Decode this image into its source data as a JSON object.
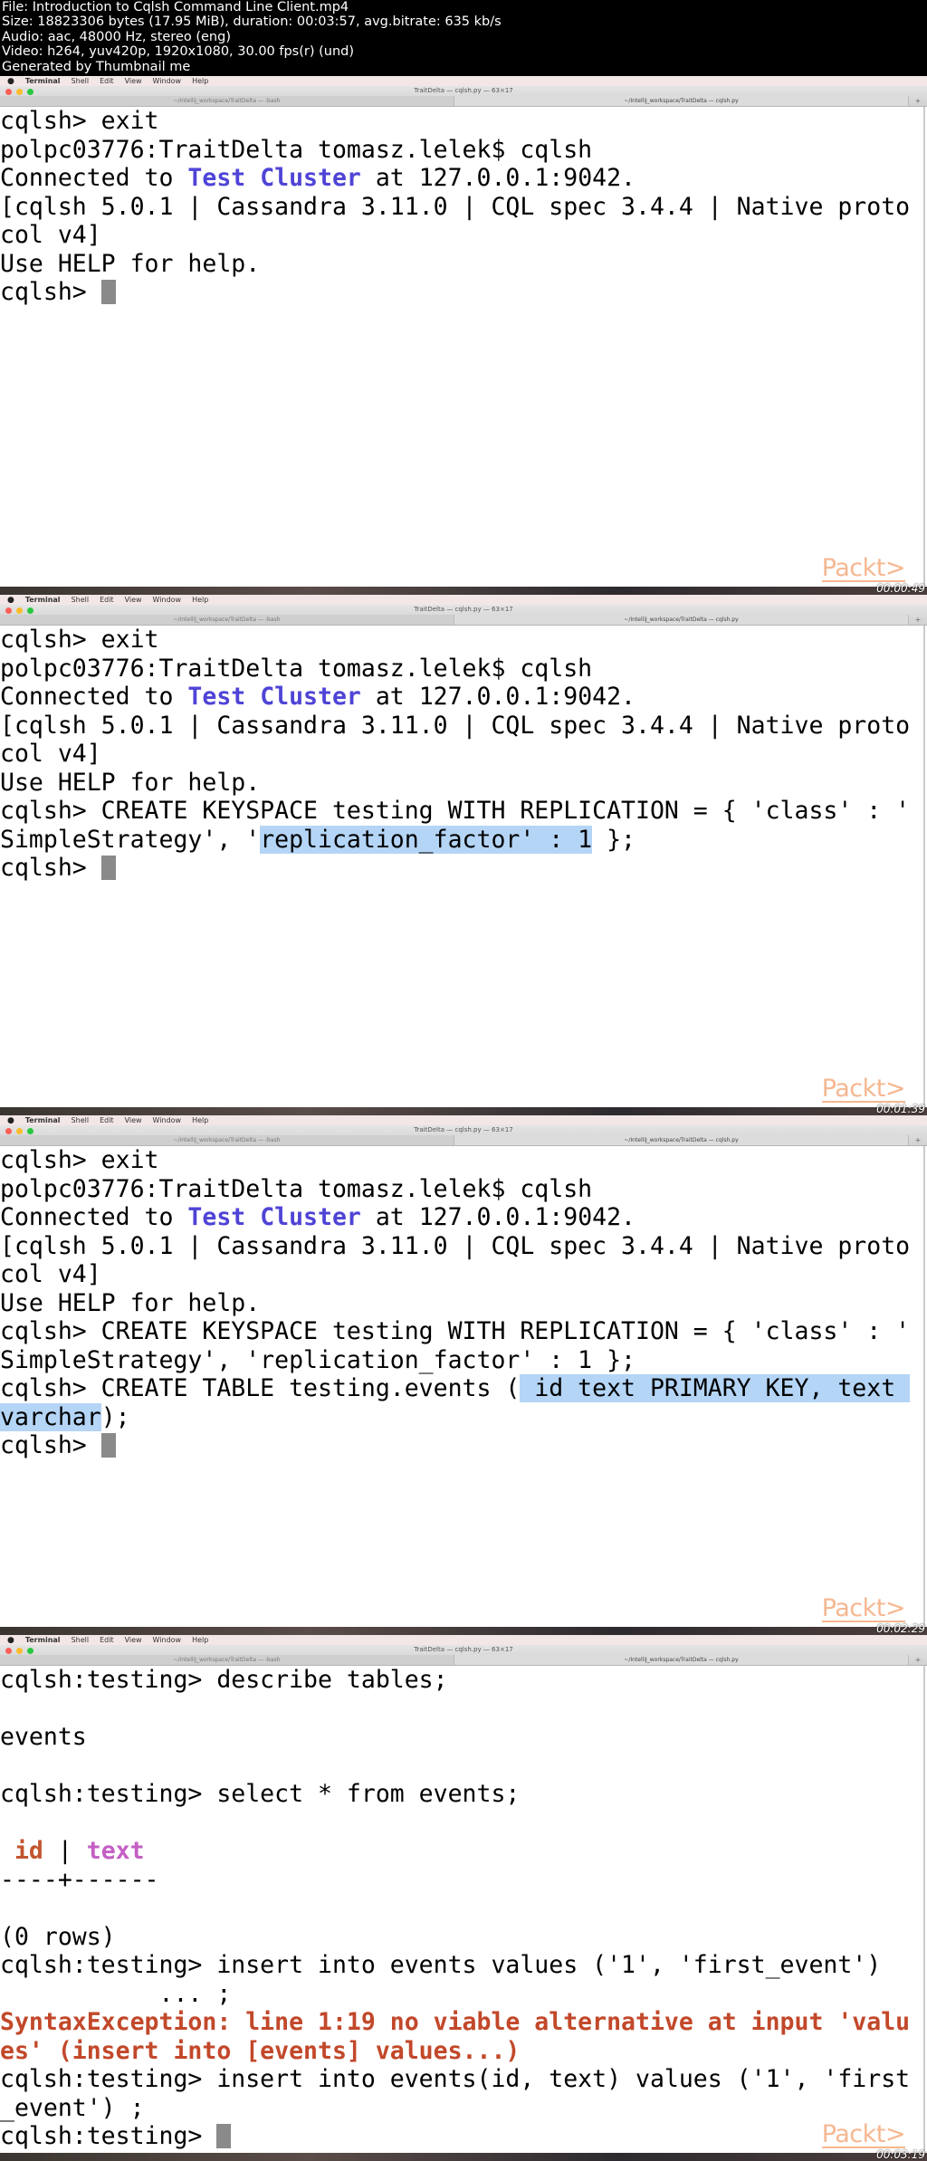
{
  "info": [
    "File: Introduction to Cqlsh Command Line Client.mp4",
    "Size: 18823306 bytes (17.95 MiB), duration: 00:03:57, avg.bitrate: 635 kb/s",
    "Audio: aac, 48000 Hz, stereo (eng)",
    "Video: h264, yuv420p, 1920x1080, 30.00 fps(r) (und)",
    "Generated by Thumbnail me"
  ],
  "menubar": {
    "apple": "",
    "items": [
      "Terminal",
      "Shell",
      "Edit",
      "View",
      "Window",
      "Help"
    ]
  },
  "window": {
    "title": "TraitDelta — cqlsh.py — 63×17",
    "tabs": [
      "~/IntelliJ_workspace/TraitDelta — -bash",
      "~/IntelliJ_workspace/TraitDelta — cqlsh.py"
    ],
    "new_tab": "+"
  },
  "logo": "Packt>",
  "colors": {
    "keyword_blue": "#4f44d6",
    "column_id": "#c2552f",
    "column_text": "#c45fc4",
    "error": "#c2482a",
    "selection": "#b4d5f6",
    "logo": "#f6b790"
  },
  "frames": [
    {
      "timestamp": "00:00:49",
      "lines": [
        [
          {
            "t": "cqlsh> exit"
          }
        ],
        [
          {
            "t": "polpc03776:TraitDelta tomasz.lelek$ cqlsh"
          }
        ],
        [
          {
            "t": "Connected to "
          },
          {
            "t": "Test Cluster",
            "c": "blue"
          },
          {
            "t": " at 127.0.0.1:9042."
          }
        ],
        [
          {
            "t": "[cqlsh 5.0.1 | Cassandra 3.11.0 | CQL spec 3.4.4 | Native proto"
          }
        ],
        [
          {
            "t": "col v4]"
          }
        ],
        [
          {
            "t": "Use HELP for help."
          }
        ],
        [
          {
            "t": "cqlsh> "
          },
          {
            "cursor": true
          }
        ]
      ]
    },
    {
      "timestamp": "00:01:39",
      "lines": [
        [
          {
            "t": "cqlsh> exit"
          }
        ],
        [
          {
            "t": "polpc03776:TraitDelta tomasz.lelek$ cqlsh"
          }
        ],
        [
          {
            "t": "Connected to "
          },
          {
            "t": "Test Cluster",
            "c": "blue"
          },
          {
            "t": " at 127.0.0.1:9042."
          }
        ],
        [
          {
            "t": "[cqlsh 5.0.1 | Cassandra 3.11.0 | CQL spec 3.4.4 | Native proto"
          }
        ],
        [
          {
            "t": "col v4]"
          }
        ],
        [
          {
            "t": "Use HELP for help."
          }
        ],
        [
          {
            "t": "cqlsh> CREATE KEYSPACE testing WITH REPLICATION = { 'class' : '"
          }
        ],
        [
          {
            "t": "SimpleStrategy', '"
          },
          {
            "t": "replication_factor' : 1",
            "c": "hl"
          },
          {
            "t": " };"
          }
        ],
        [
          {
            "t": "cqlsh> "
          },
          {
            "cursor": true
          }
        ]
      ]
    },
    {
      "timestamp": "00:02:29",
      "lines": [
        [
          {
            "t": "cqlsh> exit"
          }
        ],
        [
          {
            "t": "polpc03776:TraitDelta tomasz.lelek$ cqlsh"
          }
        ],
        [
          {
            "t": "Connected to "
          },
          {
            "t": "Test Cluster",
            "c": "blue"
          },
          {
            "t": " at 127.0.0.1:9042."
          }
        ],
        [
          {
            "t": "[cqlsh 5.0.1 | Cassandra 3.11.0 | CQL spec 3.4.4 | Native proto"
          }
        ],
        [
          {
            "t": "col v4]"
          }
        ],
        [
          {
            "t": "Use HELP for help."
          }
        ],
        [
          {
            "t": "cqlsh> CREATE KEYSPACE testing WITH REPLICATION = { 'class' : '"
          }
        ],
        [
          {
            "t": "SimpleStrategy', 'replication_factor' : 1 };"
          }
        ],
        [
          {
            "t": "cqlsh> CREATE TABLE testing.events ("
          },
          {
            "t": " id text PRIMARY KEY, text ",
            "c": "hl"
          }
        ],
        [
          {
            "t": "varchar",
            "c": "hl"
          },
          {
            "t": ");"
          }
        ],
        [
          {
            "t": "cqlsh> "
          },
          {
            "cursor": true
          }
        ]
      ]
    },
    {
      "timestamp": "00:03:19",
      "lines": [
        [
          {
            "t": "cqlsh:testing> describe tables;"
          }
        ],
        [
          {
            "t": ""
          }
        ],
        [
          {
            "t": "events"
          }
        ],
        [
          {
            "t": ""
          }
        ],
        [
          {
            "t": "cqlsh:testing> select * from events;"
          }
        ],
        [
          {
            "t": ""
          }
        ],
        [
          {
            "t": " "
          },
          {
            "t": "id",
            "c": "idc"
          },
          {
            "t": " | "
          },
          {
            "t": "text",
            "c": "textc"
          }
        ],
        [
          {
            "t": "----+------"
          }
        ],
        [
          {
            "t": ""
          }
        ],
        [
          {
            "t": "(0 rows)"
          }
        ],
        [
          {
            "t": "cqlsh:testing> insert into events values ('1', 'first_event')"
          }
        ],
        [
          {
            "t": "           ... ;"
          }
        ],
        [
          {
            "t": "SyntaxException: line 1:19 no viable alternative at input 'valu",
            "c": "err"
          }
        ],
        [
          {
            "t": "es' (insert into [events] values...)",
            "c": "err"
          }
        ],
        [
          {
            "t": "cqlsh:testing> insert into events(id, text) values ('1', 'first"
          }
        ],
        [
          {
            "t": "_event') ;"
          }
        ],
        [
          {
            "t": "cqlsh:testing> "
          },
          {
            "cursor": true
          }
        ]
      ]
    }
  ]
}
